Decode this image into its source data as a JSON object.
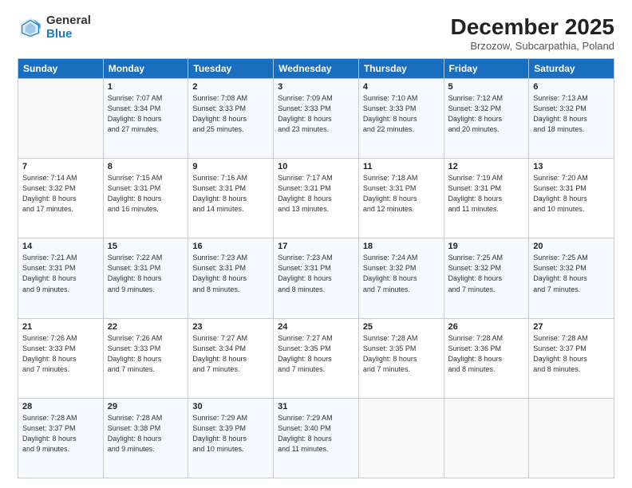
{
  "logo": {
    "general": "General",
    "blue": "Blue"
  },
  "header": {
    "title": "December 2025",
    "subtitle": "Brzozow, Subcarpathia, Poland"
  },
  "calendar": {
    "days_of_week": [
      "Sunday",
      "Monday",
      "Tuesday",
      "Wednesday",
      "Thursday",
      "Friday",
      "Saturday"
    ],
    "weeks": [
      [
        {
          "day": "",
          "info": ""
        },
        {
          "day": "1",
          "info": "Sunrise: 7:07 AM\nSunset: 3:34 PM\nDaylight: 8 hours\nand 27 minutes."
        },
        {
          "day": "2",
          "info": "Sunrise: 7:08 AM\nSunset: 3:33 PM\nDaylight: 8 hours\nand 25 minutes."
        },
        {
          "day": "3",
          "info": "Sunrise: 7:09 AM\nSunset: 3:33 PM\nDaylight: 8 hours\nand 23 minutes."
        },
        {
          "day": "4",
          "info": "Sunrise: 7:10 AM\nSunset: 3:33 PM\nDaylight: 8 hours\nand 22 minutes."
        },
        {
          "day": "5",
          "info": "Sunrise: 7:12 AM\nSunset: 3:32 PM\nDaylight: 8 hours\nand 20 minutes."
        },
        {
          "day": "6",
          "info": "Sunrise: 7:13 AM\nSunset: 3:32 PM\nDaylight: 8 hours\nand 18 minutes."
        }
      ],
      [
        {
          "day": "7",
          "info": "Sunrise: 7:14 AM\nSunset: 3:32 PM\nDaylight: 8 hours\nand 17 minutes."
        },
        {
          "day": "8",
          "info": "Sunrise: 7:15 AM\nSunset: 3:31 PM\nDaylight: 8 hours\nand 16 minutes."
        },
        {
          "day": "9",
          "info": "Sunrise: 7:16 AM\nSunset: 3:31 PM\nDaylight: 8 hours\nand 14 minutes."
        },
        {
          "day": "10",
          "info": "Sunrise: 7:17 AM\nSunset: 3:31 PM\nDaylight: 8 hours\nand 13 minutes."
        },
        {
          "day": "11",
          "info": "Sunrise: 7:18 AM\nSunset: 3:31 PM\nDaylight: 8 hours\nand 12 minutes."
        },
        {
          "day": "12",
          "info": "Sunrise: 7:19 AM\nSunset: 3:31 PM\nDaylight: 8 hours\nand 11 minutes."
        },
        {
          "day": "13",
          "info": "Sunrise: 7:20 AM\nSunset: 3:31 PM\nDaylight: 8 hours\nand 10 minutes."
        }
      ],
      [
        {
          "day": "14",
          "info": "Sunrise: 7:21 AM\nSunset: 3:31 PM\nDaylight: 8 hours\nand 9 minutes."
        },
        {
          "day": "15",
          "info": "Sunrise: 7:22 AM\nSunset: 3:31 PM\nDaylight: 8 hours\nand 9 minutes."
        },
        {
          "day": "16",
          "info": "Sunrise: 7:23 AM\nSunset: 3:31 PM\nDaylight: 8 hours\nand 8 minutes."
        },
        {
          "day": "17",
          "info": "Sunrise: 7:23 AM\nSunset: 3:31 PM\nDaylight: 8 hours\nand 8 minutes."
        },
        {
          "day": "18",
          "info": "Sunrise: 7:24 AM\nSunset: 3:32 PM\nDaylight: 8 hours\nand 7 minutes."
        },
        {
          "day": "19",
          "info": "Sunrise: 7:25 AM\nSunset: 3:32 PM\nDaylight: 8 hours\nand 7 minutes."
        },
        {
          "day": "20",
          "info": "Sunrise: 7:25 AM\nSunset: 3:32 PM\nDaylight: 8 hours\nand 7 minutes."
        }
      ],
      [
        {
          "day": "21",
          "info": "Sunrise: 7:26 AM\nSunset: 3:33 PM\nDaylight: 8 hours\nand 7 minutes."
        },
        {
          "day": "22",
          "info": "Sunrise: 7:26 AM\nSunset: 3:33 PM\nDaylight: 8 hours\nand 7 minutes."
        },
        {
          "day": "23",
          "info": "Sunrise: 7:27 AM\nSunset: 3:34 PM\nDaylight: 8 hours\nand 7 minutes."
        },
        {
          "day": "24",
          "info": "Sunrise: 7:27 AM\nSunset: 3:35 PM\nDaylight: 8 hours\nand 7 minutes."
        },
        {
          "day": "25",
          "info": "Sunrise: 7:28 AM\nSunset: 3:35 PM\nDaylight: 8 hours\nand 7 minutes."
        },
        {
          "day": "26",
          "info": "Sunrise: 7:28 AM\nSunset: 3:36 PM\nDaylight: 8 hours\nand 8 minutes."
        },
        {
          "day": "27",
          "info": "Sunrise: 7:28 AM\nSunset: 3:37 PM\nDaylight: 8 hours\nand 8 minutes."
        }
      ],
      [
        {
          "day": "28",
          "info": "Sunrise: 7:28 AM\nSunset: 3:37 PM\nDaylight: 8 hours\nand 9 minutes."
        },
        {
          "day": "29",
          "info": "Sunrise: 7:28 AM\nSunset: 3:38 PM\nDaylight: 8 hours\nand 9 minutes."
        },
        {
          "day": "30",
          "info": "Sunrise: 7:29 AM\nSunset: 3:39 PM\nDaylight: 8 hours\nand 10 minutes."
        },
        {
          "day": "31",
          "info": "Sunrise: 7:29 AM\nSunset: 3:40 PM\nDaylight: 8 hours\nand 11 minutes."
        },
        {
          "day": "",
          "info": ""
        },
        {
          "day": "",
          "info": ""
        },
        {
          "day": "",
          "info": ""
        }
      ]
    ]
  }
}
